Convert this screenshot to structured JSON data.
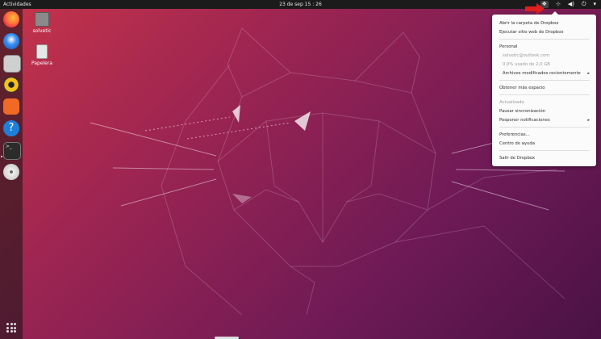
{
  "topbar": {
    "activities": "Actividades",
    "clock": "23 de sep  15 : 26",
    "tray": [
      "dropbox-icon",
      "network-icon",
      "volume-icon",
      "power-icon",
      "chevron-down-icon"
    ]
  },
  "dock": {
    "apps": [
      "firefox",
      "thunderbird",
      "files",
      "rhythmbox",
      "software",
      "help",
      "terminal",
      "disc"
    ]
  },
  "desktop": {
    "icons": [
      {
        "label": "solvetic"
      },
      {
        "label": "Papelera"
      }
    ]
  },
  "menu": {
    "items": {
      "open_folder": "Abrir la carpeta de Dropbox",
      "open_site": "Ejecutar sitio web de Dropbox",
      "personal": "Personal",
      "email": "solvetic@outlook.com",
      "usage": "0,0% usado de 2,0 GB",
      "recent": "Archivos modificados recientemente",
      "more_space": "Obtener más espacio",
      "status": "Actualizado",
      "pause": "Pausar sincronización",
      "postpone": "Posponer notificaciones",
      "prefs": "Preferencias...",
      "help": "Centro de ayuda",
      "quit": "Salir de Dropbox"
    }
  },
  "colors": {
    "menu_bg": "#fbfbfb",
    "topbar": "#1b1b1b",
    "accent_red": "#e0201c"
  }
}
